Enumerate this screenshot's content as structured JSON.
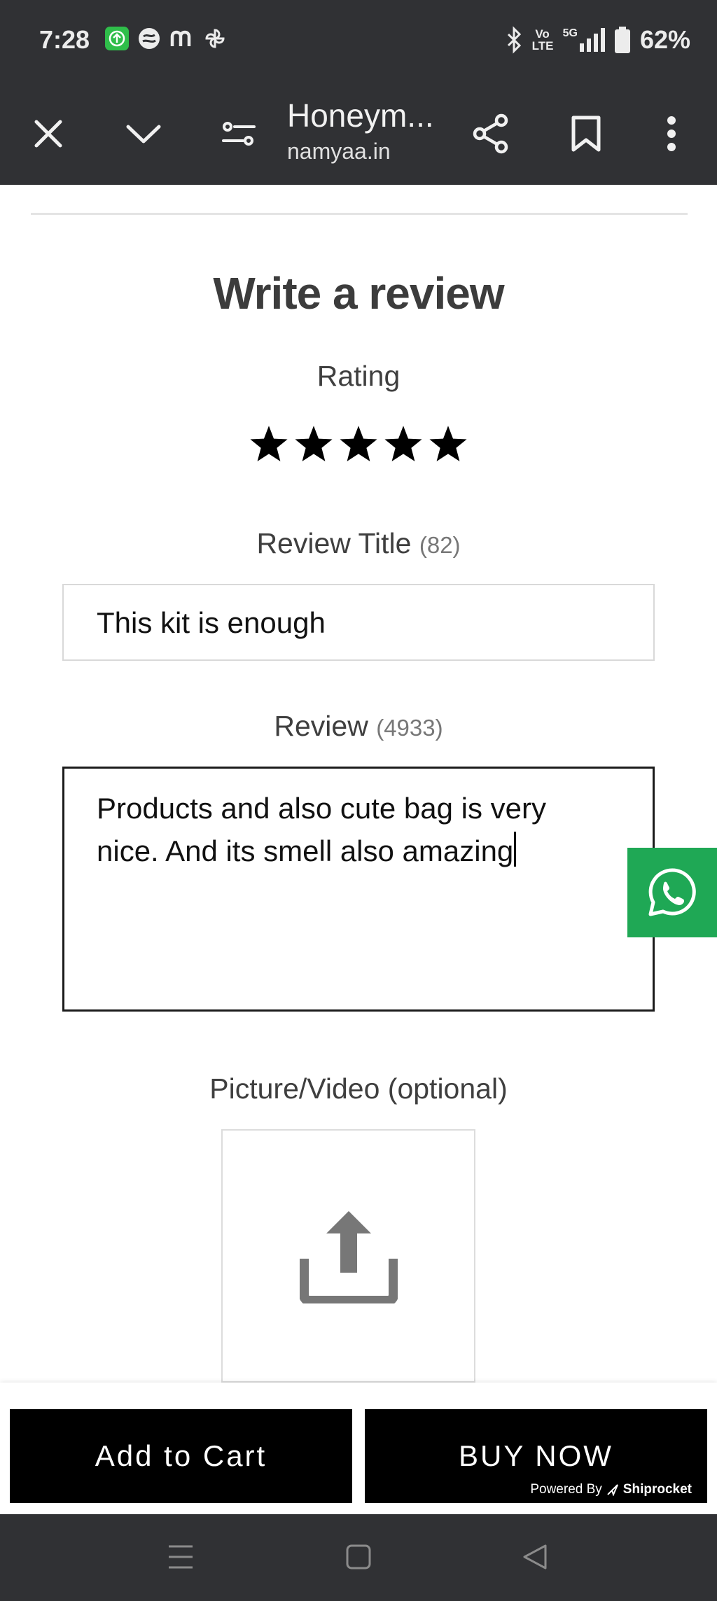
{
  "status_bar": {
    "time": "7:28",
    "network": "5G",
    "volte": "Vo LTE",
    "battery": "62%"
  },
  "toolbar": {
    "title": "Honeym...",
    "url": "namyaa.in"
  },
  "review_form": {
    "heading": "Write a review",
    "rating_label": "Rating",
    "rating_value": 5,
    "rating_max": 5,
    "title_label": "Review Title",
    "title_count": "(82)",
    "title_value": "This kit is enough",
    "review_label": "Review",
    "review_count": "(4933)",
    "review_value": "Products and also cute bag is very nice. And its smell also amazing",
    "media_label": "Picture/Video (optional)"
  },
  "actions": {
    "add_to_cart": "Add to Cart",
    "buy_now": "BUY NOW",
    "powered_by": "Powered By",
    "powered_brand": "Shiprocket"
  },
  "colors": {
    "chrome_bg": "#303134",
    "whatsapp_green": "#1fa855",
    "button_bg": "#000000"
  }
}
